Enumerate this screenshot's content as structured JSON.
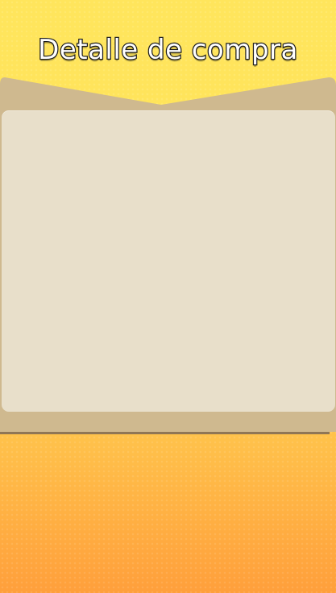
{
  "header": {
    "title": "Detalle de compra"
  },
  "colors": {
    "background_top": "#ffe55c",
    "background_bottom": "#ff9f3b",
    "panel_frame": "#cfb98f",
    "panel_content": "#e8dfca",
    "panel_shadow": "#8f7656",
    "title_fill": "#ffffff",
    "title_stroke": "#1e1e1e"
  }
}
